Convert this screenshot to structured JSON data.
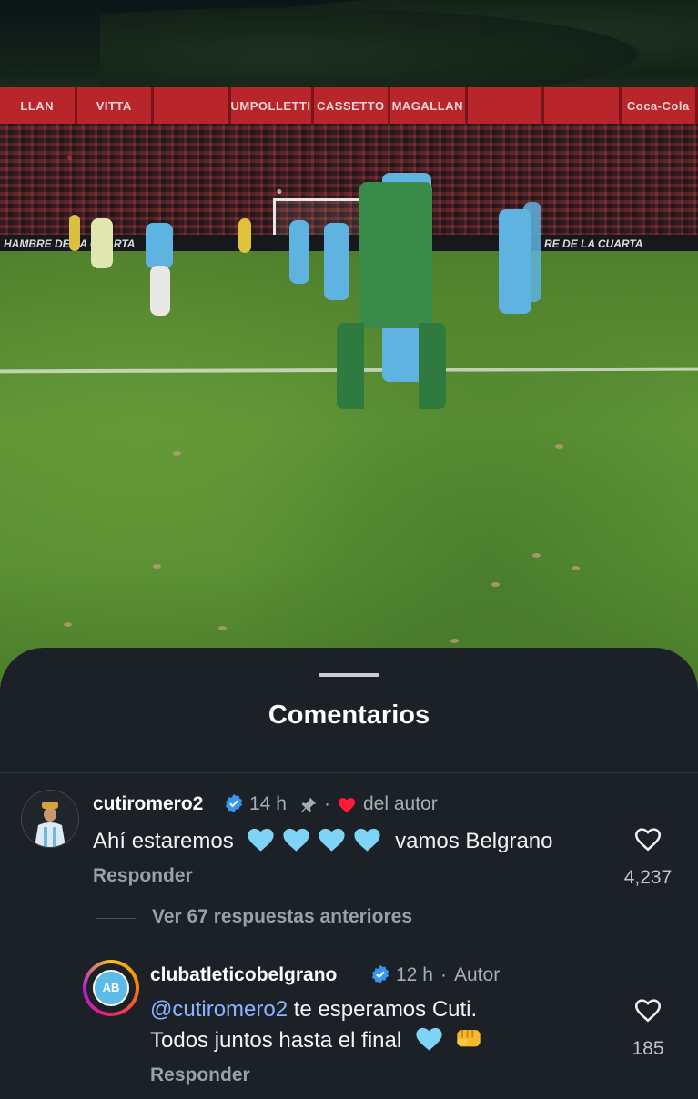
{
  "video": {
    "ads": [
      "LLAN",
      "VITTA",
      "",
      "UMPOLLETTI",
      "CASSETTO",
      "MAGALLAN",
      "",
      "",
      "Coca-Cola"
    ],
    "banner_left": "HAMBRE DE LA CUARTA",
    "banner_right": "RE DE LA CUARTA"
  },
  "sheet": {
    "title": "Comentarios"
  },
  "comments": [
    {
      "username": "cutiromero2",
      "verified": true,
      "time": "14 h",
      "pinned": true,
      "author_like_label": "del autor",
      "text_before": "Ahí estaremos",
      "emoji_hearts": 4,
      "text_after": "vamos Belgrano",
      "reply_label": "Responder",
      "like_count": "4,237"
    }
  ],
  "view_more_label": "Ver 67 respuestas anteriores",
  "reply": {
    "username": "clubatleticobelgrano",
    "verified": true,
    "time": "12 h",
    "author_badge": "Autor",
    "mention": "@cutiromero2",
    "line1_rest": "te esperamos Cuti.",
    "line2": "Todos juntos hasta el final",
    "reply_label": "Responder",
    "like_count": "185"
  },
  "colors": {
    "sheet_bg": "#1c2128",
    "mention": "#8ab4ff",
    "verified": "#3797f0",
    "heart_red": "#ff1a35",
    "heart_blue": "#7fd3f4"
  },
  "icons": [
    "verified-badge-icon",
    "pin-icon",
    "red-heart-icon",
    "like-heart-icon",
    "light-blue-heart-emoji",
    "fist-emoji"
  ]
}
